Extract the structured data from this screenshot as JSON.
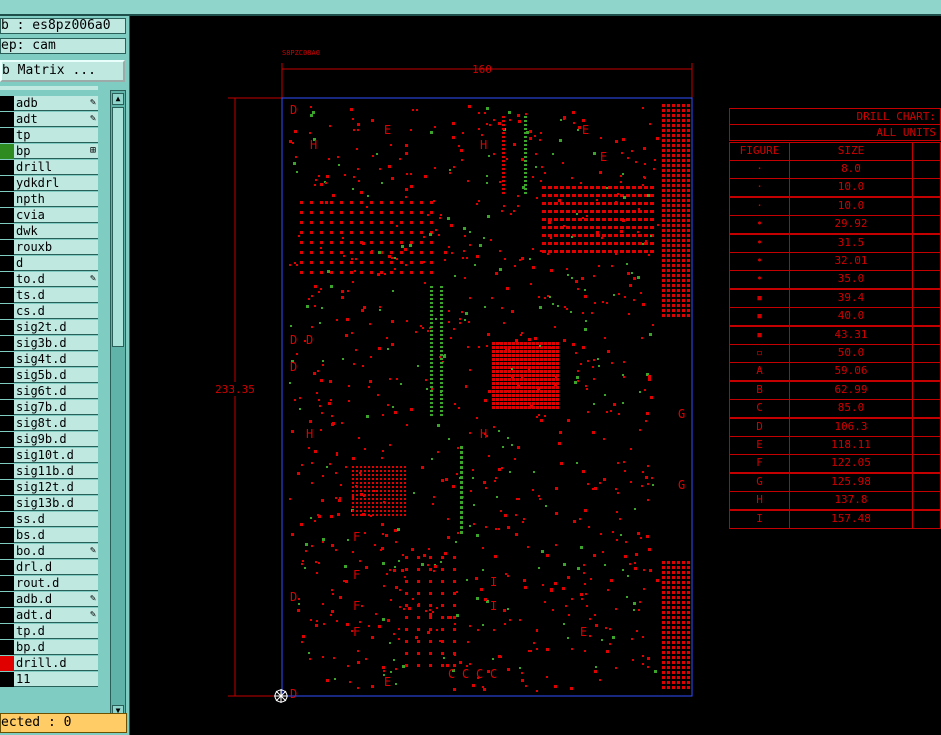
{
  "header": {
    "job_line": "b : es8pz006a0",
    "step_line": "ep: cam",
    "matrix_button": "b Matrix ..."
  },
  "layers": [
    {
      "name": "adb",
      "mark": "pencil"
    },
    {
      "name": "adt",
      "mark": "pencil"
    },
    {
      "name": "tp",
      "mark": ""
    },
    {
      "name": "bp",
      "mark": "grid",
      "active_color": "#2e8b1f"
    },
    {
      "name": "drill",
      "mark": ""
    },
    {
      "name": "ydkdrl",
      "mark": ""
    },
    {
      "name": "npth",
      "mark": ""
    },
    {
      "name": "cvia",
      "mark": ""
    },
    {
      "name": "dwk",
      "mark": ""
    },
    {
      "name": "rouxb",
      "mark": ""
    },
    {
      "name": "d",
      "mark": ""
    },
    {
      "name": "to.d",
      "mark": "pencil"
    },
    {
      "name": "ts.d",
      "mark": ""
    },
    {
      "name": "cs.d",
      "mark": ""
    },
    {
      "name": "sig2t.d",
      "mark": ""
    },
    {
      "name": "sig3b.d",
      "mark": ""
    },
    {
      "name": "sig4t.d",
      "mark": ""
    },
    {
      "name": "sig5b.d",
      "mark": ""
    },
    {
      "name": "sig6t.d",
      "mark": ""
    },
    {
      "name": "sig7b.d",
      "mark": ""
    },
    {
      "name": "sig8t.d",
      "mark": ""
    },
    {
      "name": "sig9b.d",
      "mark": ""
    },
    {
      "name": "sig10t.d",
      "mark": ""
    },
    {
      "name": "sig11b.d",
      "mark": ""
    },
    {
      "name": "sig12t.d",
      "mark": ""
    },
    {
      "name": "sig13b.d",
      "mark": ""
    },
    {
      "name": "ss.d",
      "mark": ""
    },
    {
      "name": "bs.d",
      "mark": ""
    },
    {
      "name": "bo.d",
      "mark": "pencil"
    },
    {
      "name": "drl.d",
      "mark": ""
    },
    {
      "name": "rout.d",
      "mark": ""
    },
    {
      "name": "adb.d",
      "mark": "pencil"
    },
    {
      "name": "adt.d",
      "mark": "pencil"
    },
    {
      "name": "tp.d",
      "mark": ""
    },
    {
      "name": "bp.d",
      "mark": ""
    },
    {
      "name": "drill.d",
      "mark": "",
      "active_color": "#e00000"
    },
    {
      "name": "11",
      "mark": ""
    }
  ],
  "status": {
    "selected_text": "ected : 0"
  },
  "board": {
    "label": "S8PZC08A0",
    "width_dim": "160",
    "height_dim": "233.35"
  },
  "drill_chart": {
    "title": "DRILL CHART:",
    "units": "ALL UNITS",
    "col_figure": "FIGURE",
    "col_size": "SIZE",
    "rows": [
      {
        "figure": "·",
        "size": "8.0"
      },
      {
        "figure": "·",
        "size": "10.0"
      },
      {
        "figure": "·",
        "size": "10.0"
      },
      {
        "figure": "•",
        "size": "29.92"
      },
      {
        "figure": "•",
        "size": "31.5"
      },
      {
        "figure": "•",
        "size": "32.01"
      },
      {
        "figure": "•",
        "size": "35.0"
      },
      {
        "figure": "▪",
        "size": "39.4"
      },
      {
        "figure": "▪",
        "size": "40.0"
      },
      {
        "figure": "▪",
        "size": "43.31"
      },
      {
        "figure": "▫",
        "size": "50.0"
      },
      {
        "figure": "A",
        "size": "59.06"
      },
      {
        "figure": "B",
        "size": "62.99"
      },
      {
        "figure": "C",
        "size": "85.0"
      },
      {
        "figure": "D",
        "size": "106.3"
      },
      {
        "figure": "E",
        "size": "118.11"
      },
      {
        "figure": "F",
        "size": "122.05"
      },
      {
        "figure": "G",
        "size": "125.98"
      },
      {
        "figure": "H",
        "size": "137.8"
      },
      {
        "figure": "I",
        "size": "157.48"
      }
    ]
  },
  "board_letters": [
    {
      "text": "D"
    },
    {
      "text": "H"
    },
    {
      "text": "E"
    },
    {
      "text": "H"
    },
    {
      "text": "E"
    },
    {
      "text": "E"
    },
    {
      "text": "D"
    },
    {
      "text": "D"
    },
    {
      "text": "D"
    },
    {
      "text": "G"
    },
    {
      "text": "G"
    },
    {
      "text": "H"
    },
    {
      "text": "H"
    },
    {
      "text": "F"
    },
    {
      "text": "F"
    },
    {
      "text": "F"
    },
    {
      "text": "F"
    },
    {
      "text": "I"
    },
    {
      "text": "I"
    },
    {
      "text": "E"
    },
    {
      "text": "E"
    },
    {
      "text": "C"
    },
    {
      "text": "C"
    },
    {
      "text": "C"
    },
    {
      "text": "C"
    },
    {
      "text": "D"
    },
    {
      "text": "D"
    }
  ],
  "colors": {
    "panel": "#7fcdc2",
    "row_bg": "#bfe8e1",
    "trace_red": "#e00000",
    "pad_green": "#3aa52a",
    "outline_blue": "#3050ff",
    "status_bg": "#ffcc66"
  }
}
